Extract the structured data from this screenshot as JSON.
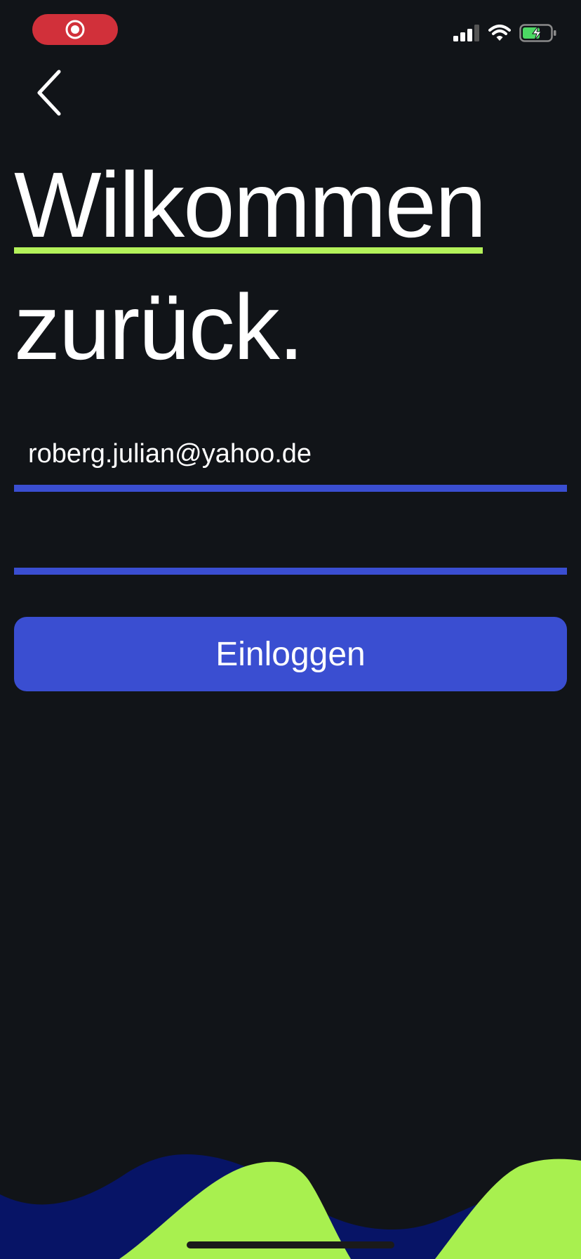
{
  "status_bar": {
    "record_icon": "screen-recording-icon",
    "signal_icon": "cellular-signal-icon",
    "wifi_icon": "wifi-icon",
    "battery_icon": "battery-charging-icon"
  },
  "nav": {
    "back_icon": "chevron-left-icon"
  },
  "title": {
    "line1": "Wilkommen",
    "line2": "zurück."
  },
  "form": {
    "email_value": "roberg.julian@yahoo.de",
    "password_value": "",
    "submit_label": "Einloggen"
  },
  "colors": {
    "background": "#111418",
    "accent_blue": "#3a4ed1",
    "accent_green": "#b4f25a",
    "wave_navy": "#071466",
    "recording_red": "#d1303a"
  }
}
